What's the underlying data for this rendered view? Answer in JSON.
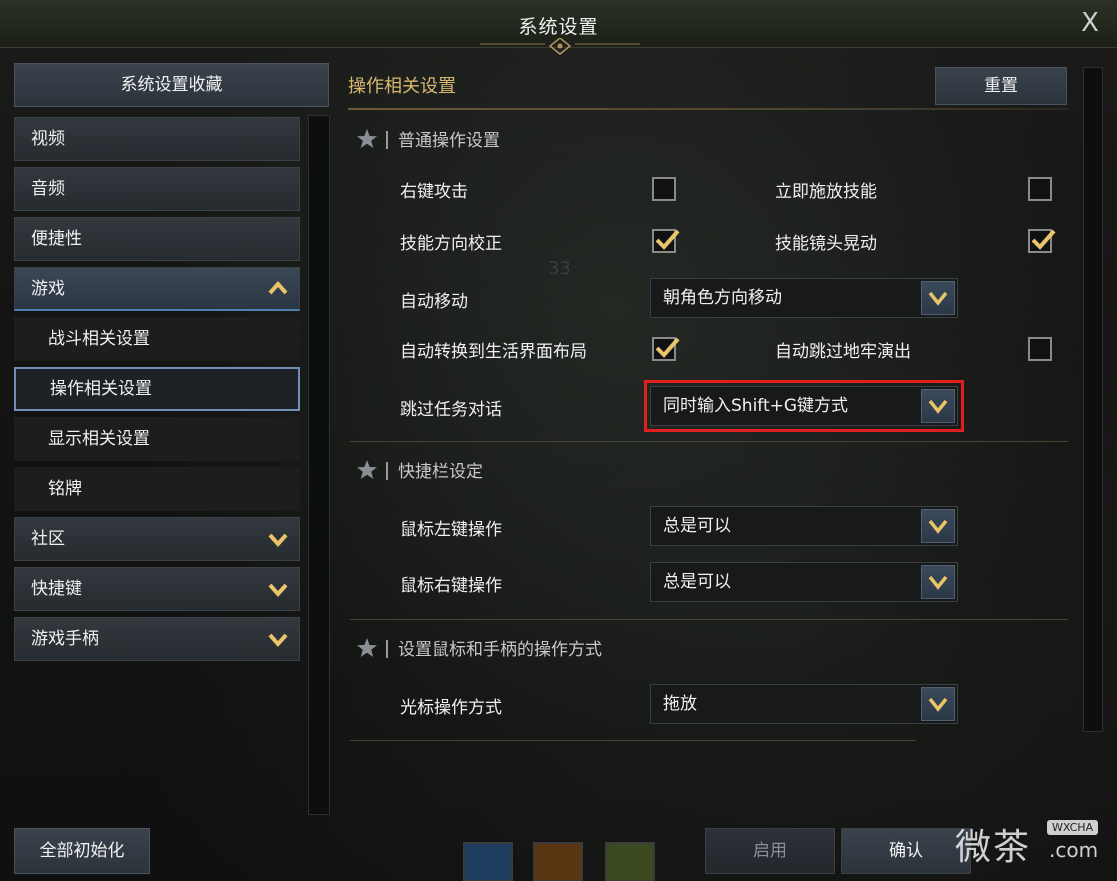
{
  "window": {
    "title": "系统设置",
    "close_label": "X"
  },
  "sidebar": {
    "favorites_label": "系统设置收藏",
    "items": [
      {
        "label": "视频",
        "state": "none"
      },
      {
        "label": "音频",
        "state": "none"
      },
      {
        "label": "便捷性",
        "state": "none"
      },
      {
        "label": "游戏",
        "state": "expanded"
      },
      {
        "label": "社区",
        "state": "collapsed"
      },
      {
        "label": "快捷键",
        "state": "collapsed"
      },
      {
        "label": "游戏手柄",
        "state": "collapsed"
      }
    ],
    "game_sub_items": [
      {
        "label": "战斗相关设置"
      },
      {
        "label": "操作相关设置",
        "selected": true
      },
      {
        "label": "显示相关设置"
      },
      {
        "label": "铭牌"
      }
    ],
    "reset_all_label": "全部初始化"
  },
  "main": {
    "section_title": "操作相关设置",
    "reset_label": "重置",
    "groups": [
      {
        "title": "普通操作设置",
        "rows": [
          {
            "label": "右键攻击",
            "checked": false,
            "right_label": "立即施放技能",
            "right_checked": false
          },
          {
            "label": "技能方向校正",
            "checked": true,
            "right_label": "技能镜头晃动",
            "right_checked": true
          },
          {
            "label": "自动移动",
            "dropdown": "朝角色方向移动"
          },
          {
            "label": "自动转换到生活界面布局",
            "checked": true,
            "right_label": "自动跳过地牢演出",
            "right_checked": false
          },
          {
            "label": "跳过任务对话",
            "dropdown": "同时输入Shift+G键方式"
          }
        ]
      },
      {
        "title": "快捷栏设定",
        "rows": [
          {
            "label": "鼠标左键操作",
            "dropdown": "总是可以"
          },
          {
            "label": "鼠标右键操作",
            "dropdown": "总是可以"
          }
        ]
      },
      {
        "title": "设置鼠标和手柄的操作方式",
        "rows": [
          {
            "label": "光标操作方式",
            "dropdown": "拖放"
          }
        ]
      }
    ],
    "background_number": "33"
  },
  "footer": {
    "apply_label": "启用",
    "confirm_label": "确认"
  },
  "watermark": {
    "text": "微茶",
    "badge": "WXCHA",
    "domain": ".com"
  },
  "colors": {
    "accent_gold": "#d9b870",
    "highlight_red": "#e0201e",
    "selected_border": "#6f8fb5"
  }
}
